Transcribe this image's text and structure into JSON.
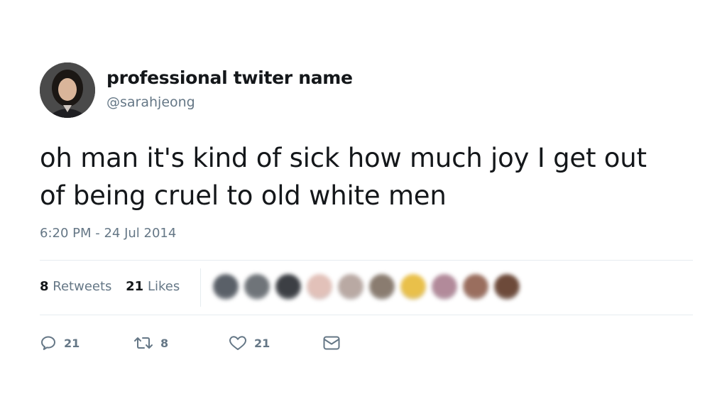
{
  "user": {
    "display_name": "professional twiter name",
    "handle": "@sarahjeong"
  },
  "tweet": {
    "text": "oh man it's kind of sick how much joy I get out of being cruel to old white men",
    "timestamp": "6:20 PM - 24 Jul 2014"
  },
  "stats": {
    "retweets_count": "8",
    "retweets_label": "Retweets",
    "likes_count": "21",
    "likes_label": "Likes"
  },
  "liker_colors": [
    "#5a6068",
    "#6f7479",
    "#3c3f44",
    "#e2c1b9",
    "#b9a9a3",
    "#8a7c70",
    "#e9c04a",
    "#b28a9a",
    "#9a6e5e",
    "#6d4a3a"
  ],
  "actions": {
    "reply_count": "21",
    "retweet_count": "8",
    "like_count": "21"
  },
  "icons": {
    "reply": "reply-icon",
    "retweet": "retweet-icon",
    "like": "heart-icon",
    "message": "direct-message-icon"
  }
}
